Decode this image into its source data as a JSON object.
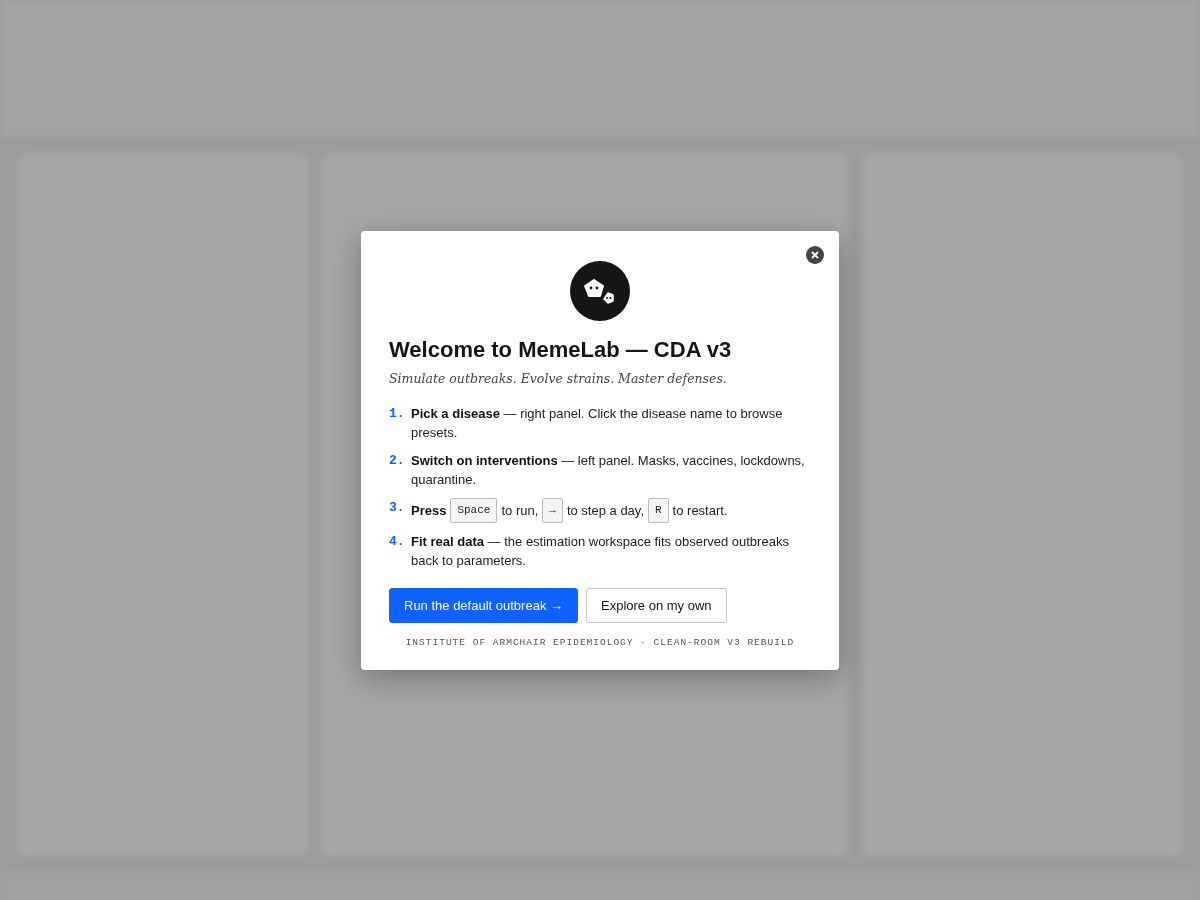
{
  "dialog": {
    "title": "Welcome to MemeLab — CDA v3",
    "subtitle": "Simulate outbreaks. Evolve strains. Master defenses.",
    "steps": [
      {
        "number": "1.",
        "parts": [
          {
            "kind": "text",
            "text": "**Pick a disease** — right panel. Click the disease name to browse presets."
          }
        ]
      },
      {
        "number": "2.",
        "parts": [
          {
            "kind": "text",
            "text": "**Switch on interventions** — left panel. Masks, vaccines, lockdowns, quarantine."
          }
        ]
      },
      {
        "number": "3.",
        "parts": [
          {
            "kind": "text",
            "text": "**Press**"
          },
          {
            "kind": "key",
            "text": "Space"
          },
          {
            "kind": "text",
            "text": "to run,"
          },
          {
            "kind": "key",
            "text": "→"
          },
          {
            "kind": "text",
            "text": "to step a day,"
          },
          {
            "kind": "key",
            "text": "R"
          },
          {
            "kind": "text",
            "text": "to restart."
          }
        ]
      },
      {
        "number": "4.",
        "parts": [
          {
            "kind": "text",
            "text": "**Fit real data** — the estimation workspace fits observed outbreaks back to parameters."
          }
        ]
      }
    ],
    "buttons": [
      {
        "label": "Run the default outbreak →",
        "kind": "primary"
      },
      {
        "label": "Explore on my own",
        "kind": "secondary"
      }
    ],
    "footer": "INSTITUTE OF ARMCHAIR EPIDEMIOLOGY · CLEAN-ROOM V3 REBUILD"
  }
}
